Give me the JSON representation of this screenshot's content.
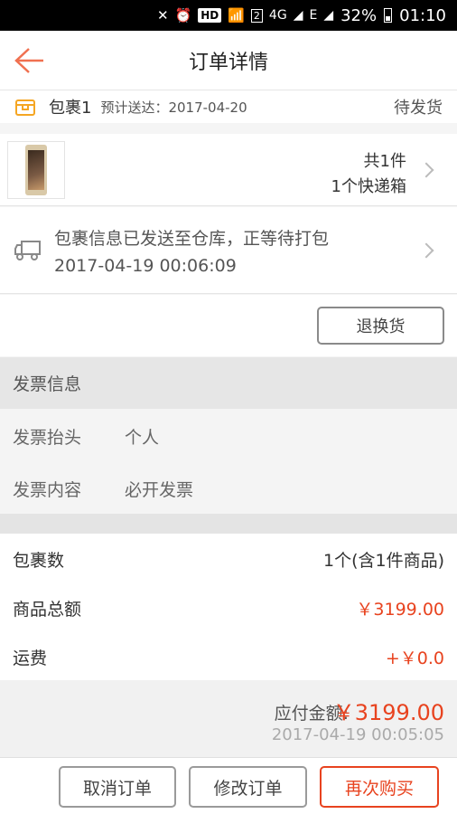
{
  "status_bar": {
    "hd": "HD",
    "sim": "2",
    "network": "4G",
    "net_e": "E",
    "battery": "32%",
    "time": "01:10"
  },
  "header": {
    "title": "订单详情",
    "back_icon": "arrow-left-icon"
  },
  "package": {
    "name": "包裹1",
    "eta": "预计送达：2017-04-20",
    "status": "待发货",
    "item_count": "共1件",
    "box_count": "1个快递箱"
  },
  "logistics": {
    "message": "包裹信息已发送至仓库，正等待打包",
    "time": "2017-04-19 00:06:09"
  },
  "return_button": "退换货",
  "invoice": {
    "section_title": "发票信息",
    "title_label": "发票抬头",
    "title_value": "个人",
    "content_label": "发票内容",
    "content_value": "必开发票"
  },
  "summary": {
    "packages_label": "包裹数",
    "packages_value_main": "1个",
    "packages_value_note": "(含1件商品)",
    "goods_label": "商品总额",
    "goods_value": "￥3199.00",
    "shipping_label": "运费",
    "shipping_value": "+￥0.0"
  },
  "total": {
    "label": "应付金额:",
    "amount": "￥3199.00",
    "timestamp": "2017-04-19 00:05:05"
  },
  "actions": {
    "cancel": "取消订单",
    "modify": "修改订单",
    "rebuy": "再次购买"
  },
  "colors": {
    "accent": "#e8431f",
    "back_arrow": "#f07050",
    "box_icon": "#f5a623"
  }
}
